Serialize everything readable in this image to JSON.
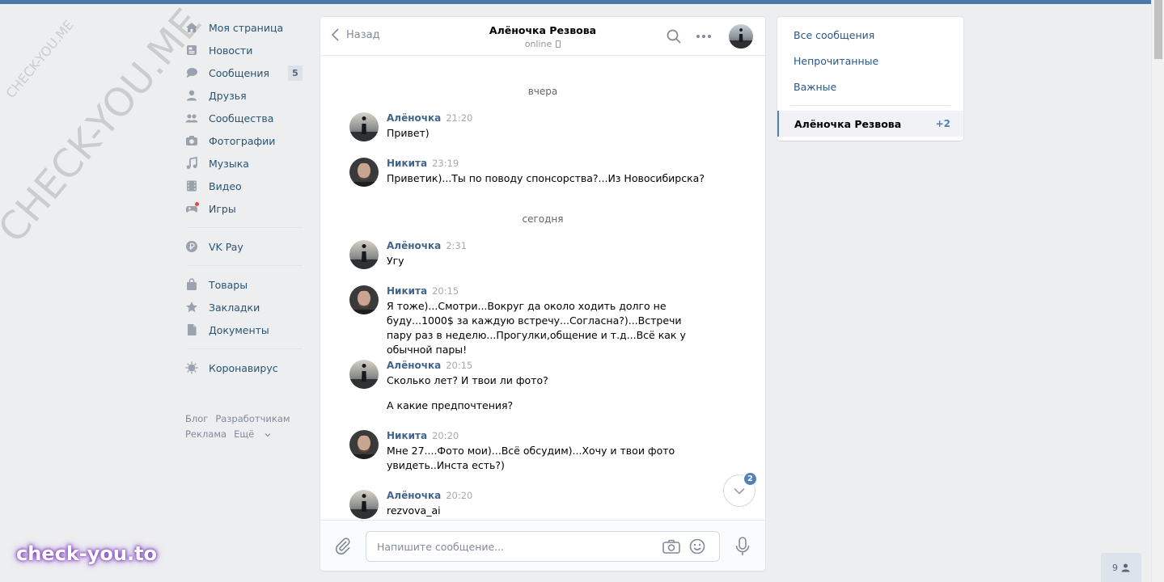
{
  "sidebar": {
    "items": [
      {
        "label": "Моя страница",
        "icon": "home-icon"
      },
      {
        "label": "Новости",
        "icon": "news-icon"
      },
      {
        "label": "Сообщения",
        "icon": "messages-icon",
        "badge": "5"
      },
      {
        "label": "Друзья",
        "icon": "friend-icon"
      },
      {
        "label": "Сообщества",
        "icon": "groups-icon"
      },
      {
        "label": "Фотографии",
        "icon": "camera-icon"
      },
      {
        "label": "Музыка",
        "icon": "music-icon"
      },
      {
        "label": "Видео",
        "icon": "video-icon"
      },
      {
        "label": "Игры",
        "icon": "gamepad-icon"
      },
      {
        "label": "VK Pay",
        "icon": "ruble-icon"
      },
      {
        "label": "Товары",
        "icon": "bag-icon"
      },
      {
        "label": "Закладки",
        "icon": "star-icon"
      },
      {
        "label": "Документы",
        "icon": "document-icon"
      },
      {
        "label": "Коронавирус",
        "icon": "virus-icon"
      }
    ],
    "footer": [
      "Блог",
      "Разработчикам",
      "Реклама",
      "Ещё"
    ]
  },
  "chat": {
    "back_label": "Назад",
    "peer_name": "Алёночка Резвова",
    "peer_status": "online",
    "days": [
      "вчера",
      "сегодня"
    ],
    "messages": [
      {
        "author": "Алёночка",
        "time": "21:20",
        "text": "Привет)"
      },
      {
        "author": "Никита",
        "time": "23:19",
        "text": "Приветик)...Ты по поводу спонсорства?...Из Новосибирска?"
      },
      {
        "author": "Алёночка",
        "time": "2:31",
        "text": "Угу"
      },
      {
        "author": "Никита",
        "time": "20:15",
        "text": "Я тоже)...Смотри...Вокруг да около ходить долго не буду...1000$ за каждую встречу...Согласна?)...Встречи пару раз в неделю...Прогулки,общение и т.д...Всё как у обычной пары!"
      },
      {
        "author": "Алёночка",
        "time": "20:15",
        "text": "Сколько лет? И твои ли фото?",
        "text2": "А какие предпочтения?"
      },
      {
        "author": "Никита",
        "time": "20:20",
        "text": "Мне 27....Фото мои)...Всё обсудим)...Хочу и твои фото увидеть..Инста есть?)"
      },
      {
        "author": "Алёночка",
        "time": "20:20",
        "text": "rezvova_ai"
      }
    ],
    "unread_badge": "2",
    "composer_placeholder": "Напишите сообщение..."
  },
  "right_panel": {
    "items": [
      "Все сообщения",
      "Непрочитанные",
      "Важные"
    ],
    "active_chat": {
      "name": "Алёночка Резвова",
      "count": "+2"
    }
  },
  "online_counter": "9",
  "watermarks": [
    "CHECK-YOU.ME",
    "CHECK-YOU.ME",
    "check-you.to"
  ],
  "colors": {
    "accent": "#4a76a8",
    "link": "#2a5885",
    "author": "#42648b",
    "badge": "#5181b8"
  }
}
